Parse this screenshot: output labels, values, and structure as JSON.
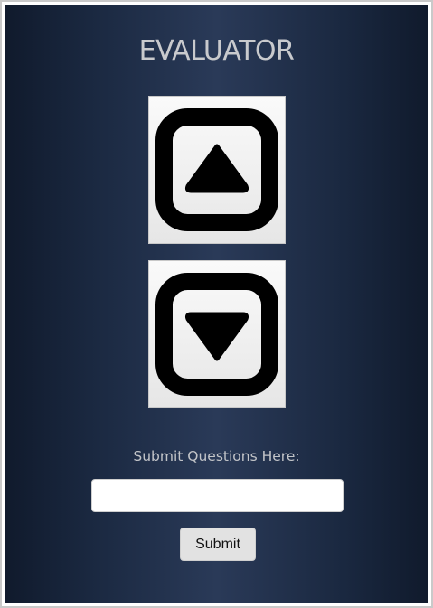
{
  "app": {
    "title": "EVALUATOR"
  },
  "vote": {
    "up_icon": "arrow-up-square-icon",
    "down_icon": "arrow-down-square-icon"
  },
  "questions": {
    "prompt": "Submit Questions Here:",
    "input_value": "",
    "input_placeholder": "",
    "submit_label": "Submit"
  },
  "colors": {
    "background_dark": "#101a2c",
    "background_mid": "#2a3a58",
    "title_text": "#c9cacd",
    "button_face": "#e2e2e2"
  }
}
